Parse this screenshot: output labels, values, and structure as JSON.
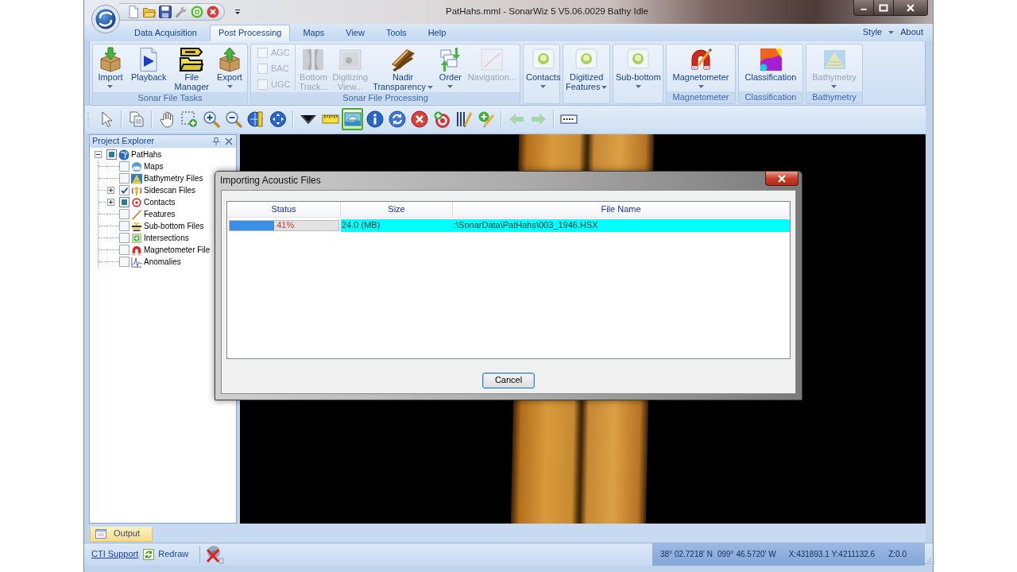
{
  "window": {
    "title": "PatHahs.mml - SonarWiz 5 V5.06.0029 Bathy Idle"
  },
  "ribbon_tabs": [
    {
      "label": "Data Acquisition",
      "selected": false
    },
    {
      "label": "Post Processing",
      "selected": true
    },
    {
      "label": "Maps",
      "selected": false
    },
    {
      "label": "View",
      "selected": false
    },
    {
      "label": "Tools",
      "selected": false
    },
    {
      "label": "Help",
      "selected": false
    }
  ],
  "ribbon_menu": [
    {
      "label": "Style",
      "dropdown": true
    },
    {
      "label": "About",
      "dropdown": false
    }
  ],
  "ribbon_groups": [
    {
      "label": "Sonar File Tasks",
      "items": [
        {
          "kind": "large",
          "label": "Import",
          "dropdown": true,
          "disabled": false
        },
        {
          "kind": "large",
          "label": "Playback",
          "dropdown": false,
          "disabled": false
        },
        {
          "kind": "large",
          "label": "File\nManager",
          "dropdown": false,
          "disabled": false
        },
        {
          "kind": "large",
          "label": "Export",
          "dropdown": true,
          "disabled": false
        }
      ]
    },
    {
      "label": "Sonar File Processing",
      "items": [
        {
          "kind": "checks",
          "checks": [
            {
              "label": "AGC",
              "checked": false,
              "disabled": true
            },
            {
              "label": "BAC",
              "checked": false,
              "disabled": true
            },
            {
              "label": "UGC",
              "checked": false,
              "disabled": true
            }
          ]
        },
        {
          "kind": "large",
          "label": "Bottom\nTrack...",
          "dropdown": false,
          "disabled": true
        },
        {
          "kind": "large",
          "label": "Digitizing\nView...",
          "dropdown": false,
          "disabled": true
        },
        {
          "kind": "large",
          "label": "Nadir\nTransparency",
          "dropdown": true,
          "disabled": false
        },
        {
          "kind": "large",
          "label": "Order",
          "dropdown": true,
          "disabled": false
        },
        {
          "kind": "large",
          "label": "Navigation...",
          "dropdown": false,
          "disabled": true
        }
      ]
    },
    {
      "items": [
        {
          "kind": "large",
          "label": "Contacts",
          "dropdown": true,
          "disabled": false
        }
      ]
    },
    {
      "items": [
        {
          "kind": "large",
          "label": "Digitized\nFeatures",
          "dropdown": true,
          "disabled": false
        }
      ]
    },
    {
      "items": [
        {
          "kind": "large",
          "label": "Sub-bottom",
          "dropdown": true,
          "disabled": false
        }
      ]
    },
    {
      "label": "Magnetometer",
      "items": [
        {
          "kind": "large",
          "label": "Magnetometer",
          "dropdown": true,
          "disabled": false
        }
      ]
    },
    {
      "label": "Classification",
      "items": [
        {
          "kind": "large",
          "label": "Classification",
          "dropdown": false,
          "disabled": false
        }
      ]
    },
    {
      "label": "Bathymetry",
      "items": [
        {
          "kind": "large",
          "label": "Bathymetry",
          "dropdown": true,
          "disabled": true
        }
      ]
    }
  ],
  "toolbar": {
    "buttons": [
      {
        "selected": false,
        "disabled": false
      },
      {
        "selected": false,
        "disabled": false
      },
      {
        "selected": false,
        "disabled": false
      },
      {
        "selected": false,
        "disabled": false
      },
      {
        "selected": false,
        "disabled": false
      },
      {
        "selected": false,
        "disabled": false
      },
      {
        "selected": false,
        "disabled": false
      },
      {
        "selected": false,
        "disabled": false
      },
      {
        "selected": false,
        "disabled": false
      },
      {
        "selected": false,
        "disabled": false
      },
      {
        "selected": true,
        "disabled": false
      },
      {
        "selected": false,
        "disabled": false
      },
      {
        "selected": false,
        "disabled": false
      },
      {
        "selected": false,
        "disabled": false
      },
      {
        "selected": false,
        "disabled": false
      },
      {
        "selected": false,
        "disabled": false
      },
      {
        "selected": false,
        "disabled": false
      },
      {
        "selected": false,
        "disabled": true
      },
      {
        "selected": false,
        "disabled": true
      },
      {
        "selected": false,
        "disabled": false
      }
    ]
  },
  "project_explorer": {
    "title": "Project Explorer",
    "tree": [
      {
        "label": "PatHahs",
        "checked": false,
        "indeterminate": true,
        "expanded": true,
        "children": [
          {
            "label": "Maps",
            "checked": false,
            "indeterminate": false
          },
          {
            "label": "Bathymetry Files",
            "checked": false,
            "indeterminate": false
          },
          {
            "label": "Sidescan Files",
            "checked": true,
            "expanded": false
          },
          {
            "label": "Contacts",
            "checked": false,
            "indeterminate": true,
            "expanded": false
          },
          {
            "label": "Features",
            "checked": false,
            "indeterminate": false
          },
          {
            "label": "Sub-bottom Files",
            "checked": false,
            "indeterminate": false
          },
          {
            "label": "Intersections",
            "checked": false,
            "indeterminate": false
          },
          {
            "label": "Magnetometer File",
            "checked": false,
            "indeterminate": false
          },
          {
            "label": "Anomalies",
            "checked": false,
            "indeterminate": false
          }
        ]
      }
    ]
  },
  "dialog": {
    "title": "Importing Acoustic Files",
    "columns": [
      "Status",
      "Size",
      "File Name"
    ],
    "rows": [
      {
        "selected": true,
        "status": {
          "level": 0.41,
          "label": "41%"
        },
        "size": "24.0 (MB)",
        "file_name": ":\\SonarData\\PatHahs\\003_1946.HSX"
      }
    ],
    "buttons": [
      {
        "label": "Cancel",
        "focused": true
      }
    ]
  },
  "output_panel": {
    "tab": "Output"
  },
  "status_bar": {
    "link": "CTI Support",
    "redraw": "Redraw",
    "latitude": "38° 02.7218' N",
    "longitude": "099° 46.5720' W",
    "xy": "X:431893.1 Y:4211132.6",
    "z": "Z:0.0"
  }
}
